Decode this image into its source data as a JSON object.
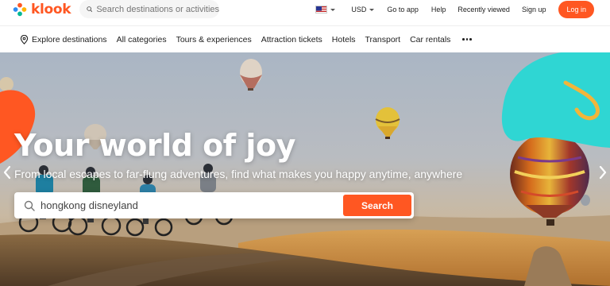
{
  "brand": {
    "name": "klook",
    "color": "#ff5722"
  },
  "header": {
    "search_placeholder": "Search destinations or activities",
    "currency": "USD",
    "go_to_app": "Go to app",
    "help": "Help",
    "recently_viewed": "Recently viewed",
    "sign_up": "Sign up",
    "log_in": "Log in"
  },
  "nav": {
    "explore": "Explore destinations",
    "items": [
      "All categories",
      "Tours & experiences",
      "Attraction tickets",
      "Hotels",
      "Transport",
      "Car rentals"
    ]
  },
  "hero": {
    "title": "Your world of joy",
    "subtitle": "From local escapes to far-flung adventures, find what makes you happy anytime, anywhere",
    "search_value": "hongkong disneyland",
    "search_button": "Search"
  },
  "icons": [
    "search-icon",
    "us-flag-icon",
    "location-pin-icon",
    "more-dots-icon",
    "chevron-left-icon",
    "chevron-right-icon"
  ]
}
